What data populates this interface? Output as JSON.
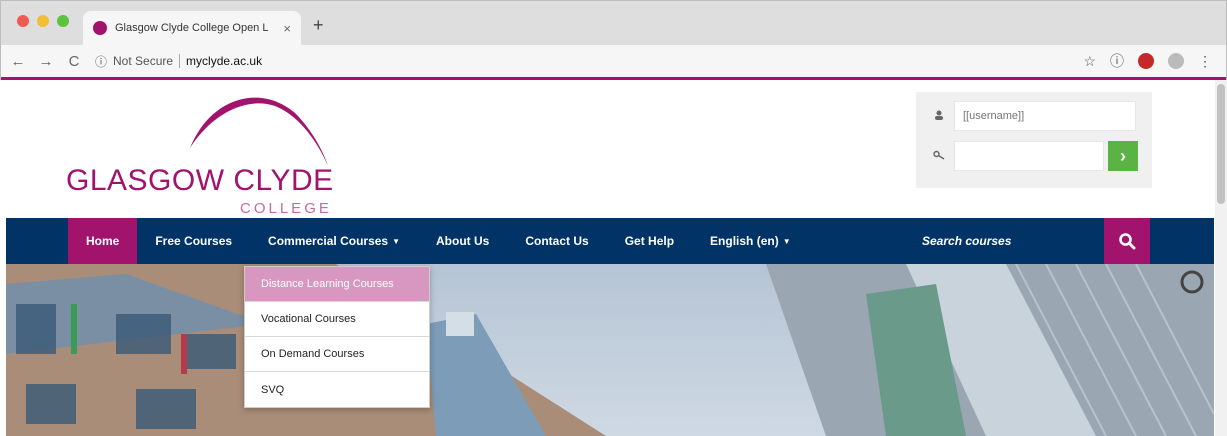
{
  "browser": {
    "tab_title": "Glasgow Clyde College Open L",
    "tab_close": "×",
    "new_tab": "+",
    "security": "Not Secure",
    "url": "myclyde.ac.uk"
  },
  "site": {
    "logo_name": "GLASGOW CLYDE",
    "logo_sub": "COLLEGE"
  },
  "login": {
    "username_placeholder": "[[username]]",
    "password_placeholder": ""
  },
  "nav": {
    "items": [
      {
        "label": "Home"
      },
      {
        "label": "Free Courses"
      },
      {
        "label": "Commercial Courses"
      },
      {
        "label": "About Us"
      },
      {
        "label": "Contact Us"
      },
      {
        "label": "Get Help"
      },
      {
        "label": "English (en)"
      }
    ],
    "search_placeholder": "Search courses"
  },
  "dropdown": {
    "options": [
      {
        "label": "Distance Learning Courses"
      },
      {
        "label": "Vocational Courses"
      },
      {
        "label": "On Demand Courses"
      },
      {
        "label": "SVQ"
      }
    ]
  },
  "colors": {
    "brand_magenta": "#a2136d",
    "nav_blue": "#013366",
    "login_green": "#5bb343"
  }
}
